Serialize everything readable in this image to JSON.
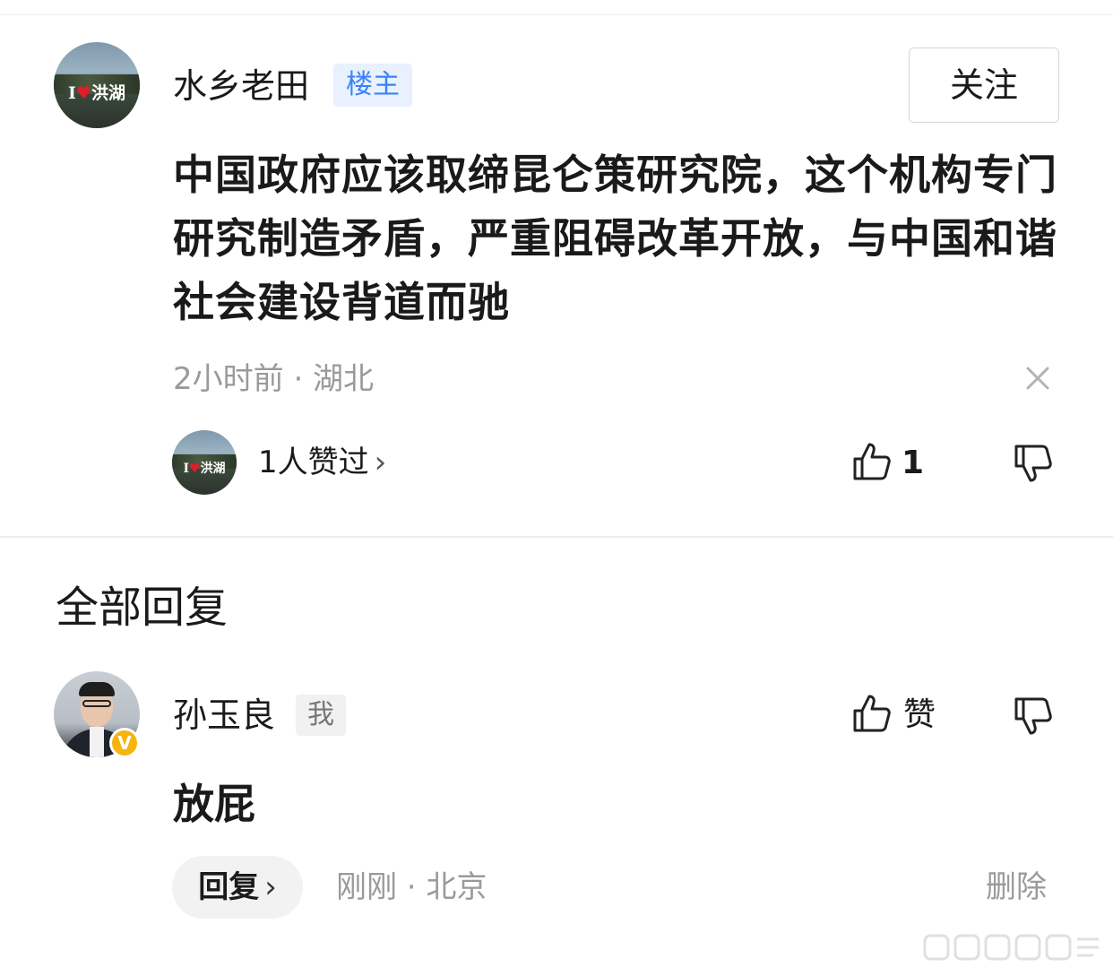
{
  "original_post": {
    "author": "水乡老田",
    "author_badge": "楼主",
    "avatar_text": "洪湖",
    "follow_label": "关注",
    "content": "中国政府应该取缔昆仑策研究院，这个机构专门研究制造矛盾，严重阻碍改革开放，与中国和谐社会建设背道而驰",
    "meta": "2小时前 · 湖北",
    "liked_by": "1人赞过",
    "like_count": "1",
    "icons": {
      "close": "close-icon",
      "like": "thumbs-up-icon",
      "dislike": "thumbs-down-icon",
      "chevron": "chevron-right-icon"
    }
  },
  "section_title": "全部回复",
  "reply": {
    "author": "孙玉良",
    "author_badge": "我",
    "verified_badge": "V",
    "like_label": "赞",
    "content": "放屁",
    "reply_button": "回复",
    "meta": "刚刚 · 北京",
    "delete_label": "删除"
  },
  "colors": {
    "badge_blue": "#3b82f6",
    "badge_blue_bg": "#e8f1fd",
    "meta_gray": "#9a9a9a",
    "verified_gold": "#f6b40f"
  }
}
